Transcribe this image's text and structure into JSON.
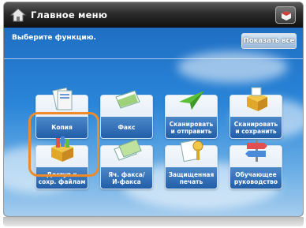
{
  "header": {
    "title": "Главное меню"
  },
  "toolbar": {
    "prompt": "Выберите функцию.",
    "show_all_label": "Показать все"
  },
  "tiles": [
    {
      "label": "Копия",
      "icon": "copy-icon"
    },
    {
      "label": "Факс",
      "icon": "fax-icon"
    },
    {
      "label": "Сканировать\nи отправить",
      "icon": "scan-send-icon"
    },
    {
      "label": "Сканировать\nи сохранить",
      "icon": "scan-save-icon"
    },
    {
      "label": "Доступ к\nсохр. файлам",
      "icon": "stored-files-icon",
      "selected": true
    },
    {
      "label": "Яч. факса/\nИ-факса",
      "icon": "fax-inbox-icon"
    },
    {
      "label": "Защищенная\nпечать",
      "icon": "secure-print-icon"
    },
    {
      "label": "Обучающее\nруководство",
      "icon": "tutorial-icon"
    }
  ],
  "colors": {
    "selected_ring": "#ee8a2a",
    "tile_label_bg": "#225ea8"
  }
}
